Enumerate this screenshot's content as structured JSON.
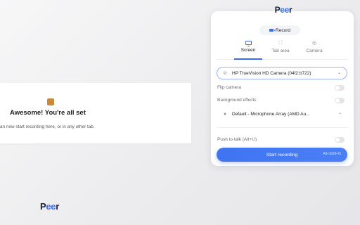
{
  "welcome": {
    "title": "Awesome! You're all set",
    "subtitle": "an now start recording here, or in any other tab."
  },
  "brand": {
    "name_start": "P",
    "name_highlight": "ee",
    "name_end": "r"
  },
  "popup": {
    "record_label": "Record",
    "tabs": [
      {
        "label": "Screen",
        "icon": "monitor-icon"
      },
      {
        "label": "Tab area",
        "icon": "crop-area-icon"
      },
      {
        "label": "Camera",
        "icon": "camera-icon"
      }
    ],
    "active_tab": "Screen",
    "camera_select": {
      "value": "HP TrueVision HD Camera (04f2:b722)",
      "icon": "camera-off-icon"
    },
    "flip_camera_label": "Flip camera",
    "background_effects_label": "Background effects",
    "mic_select": {
      "value": "Default - Microphone Array (AMD Au...",
      "icon": "microphone-icon"
    },
    "push_to_talk_label": "Push to talk (Alt+U)",
    "start_button_label": "Start recording",
    "start_shortcut": "Alt+Shift+G"
  },
  "colors": {
    "accent": "#3a6cf0",
    "brand_dark": "#1a1f36"
  }
}
